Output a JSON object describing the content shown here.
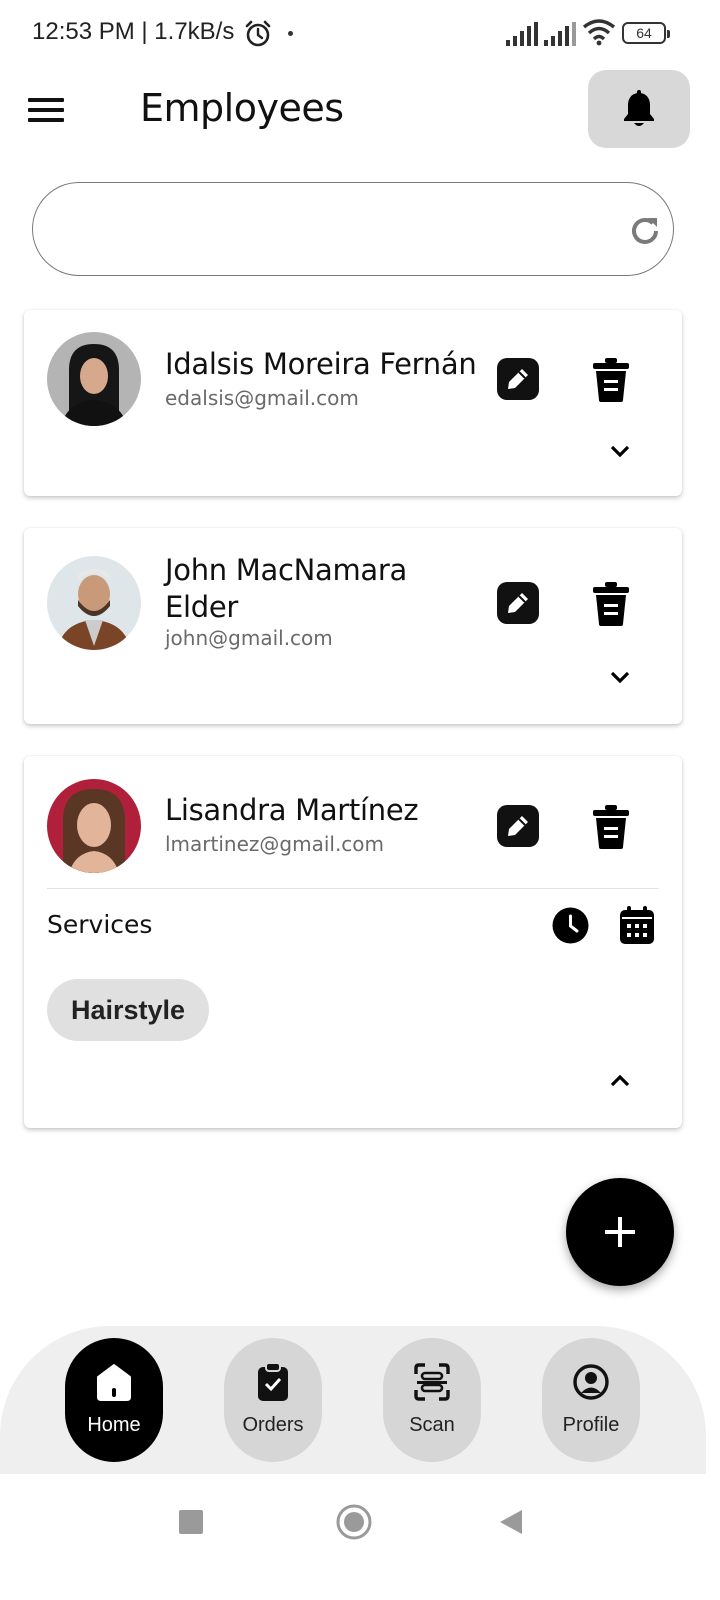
{
  "status_bar": {
    "time_speed": "12:53 PM | 1.7kB/s",
    "battery": "64"
  },
  "header": {
    "title": "Employees",
    "menu_icon": "hamburger-menu-icon",
    "notification_icon": "bell-icon"
  },
  "search": {
    "placeholder": "",
    "value": "",
    "refresh_icon": "refresh-icon"
  },
  "employees": [
    {
      "name": "Idalsis Moreira Fernán",
      "email": "edalsis@gmail.com",
      "expanded": false
    },
    {
      "name": "John MacNamara Elder",
      "email": "john@gmail.com",
      "expanded": false
    },
    {
      "name": "Lisandra Martínez",
      "email": "lmartinez@gmail.com",
      "expanded": true,
      "services_label": "Services",
      "services": [
        "Hairstyle"
      ]
    }
  ],
  "fab": {
    "icon": "plus-icon"
  },
  "bottom_nav": [
    {
      "label": "Home",
      "icon": "home-icon",
      "active": true
    },
    {
      "label": "Orders",
      "icon": "clipboard-icon",
      "active": false
    },
    {
      "label": "Scan",
      "icon": "scan-icon",
      "active": false
    },
    {
      "label": "Profile",
      "icon": "profile-icon",
      "active": false
    }
  ],
  "colors": {
    "accent": "#000000",
    "chip_bg": "#e0e0e0",
    "nav_bg": "#efefef",
    "secondary_text": "#6a6a6a"
  }
}
